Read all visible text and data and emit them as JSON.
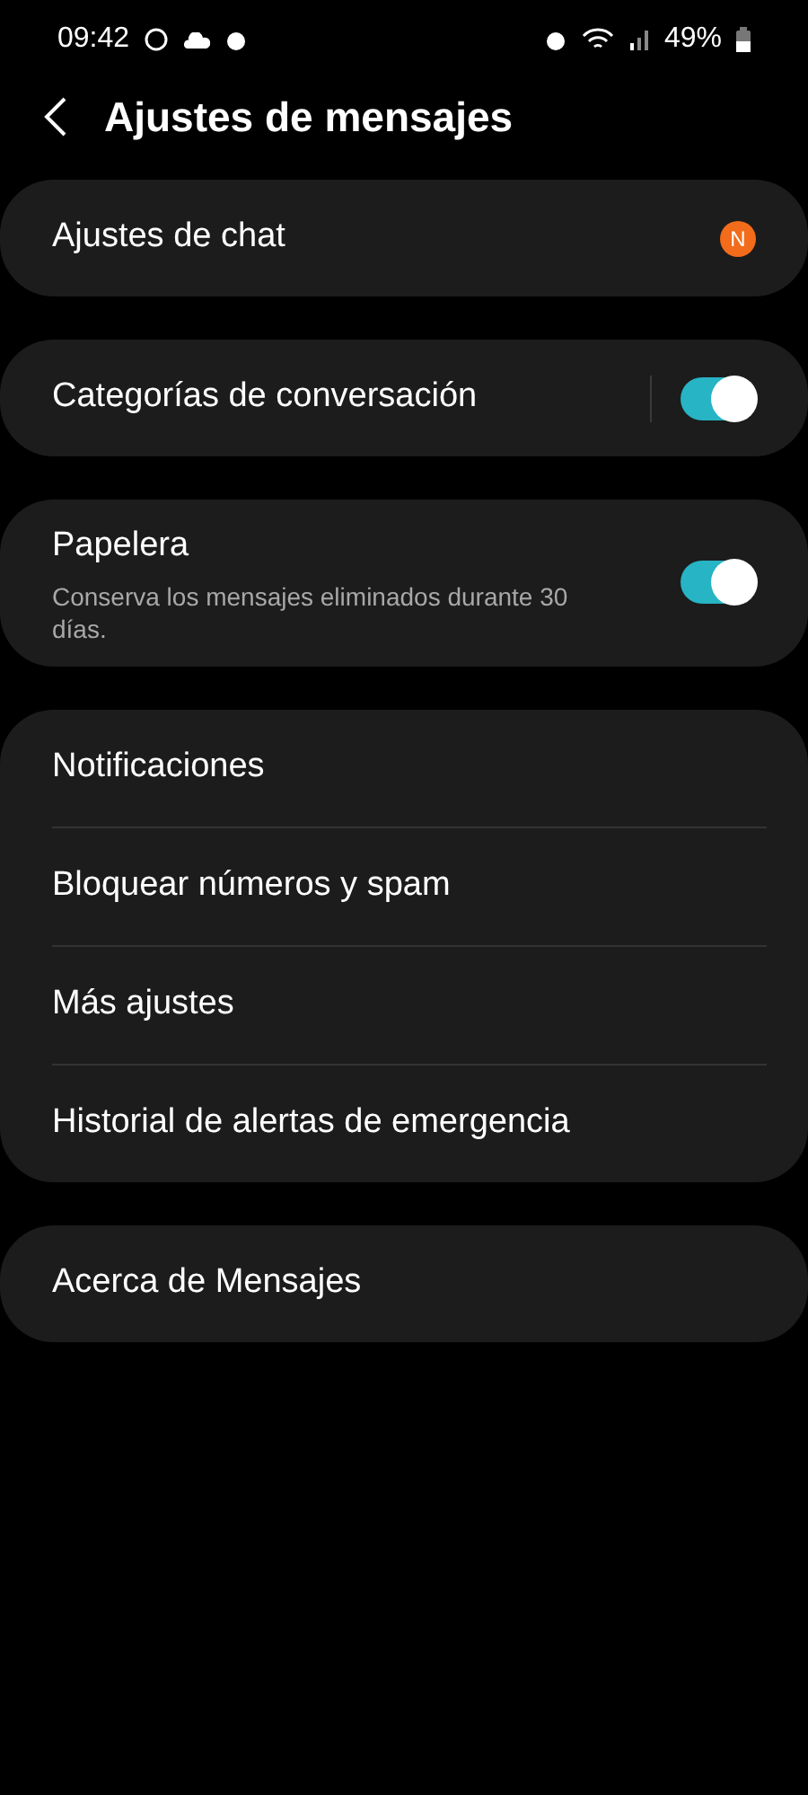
{
  "status_bar": {
    "time": "09:42",
    "battery": "49%"
  },
  "header": {
    "title": "Ajustes de mensajes"
  },
  "cards": [
    {
      "items": [
        {
          "kind": "badge",
          "label": "Ajustes de chat",
          "badge": "N"
        }
      ]
    },
    {
      "items": [
        {
          "kind": "switch",
          "label": "Categorías de conversación",
          "divider": true,
          "on": true
        }
      ]
    },
    {
      "items": [
        {
          "kind": "switch",
          "label": "Papelera",
          "subtitle": "Conserva los mensajes eliminados durante 30 días.",
          "on": true
        }
      ]
    },
    {
      "items": [
        {
          "kind": "plain",
          "label": "Notificaciones"
        },
        {
          "kind": "plain",
          "label": "Bloquear números y spam"
        },
        {
          "kind": "plain",
          "label": "Más ajustes"
        },
        {
          "kind": "plain",
          "label": "Historial de alertas de emergencia"
        }
      ]
    },
    {
      "items": [
        {
          "kind": "plain",
          "label": "Acerca de Mensajes"
        }
      ]
    }
  ]
}
